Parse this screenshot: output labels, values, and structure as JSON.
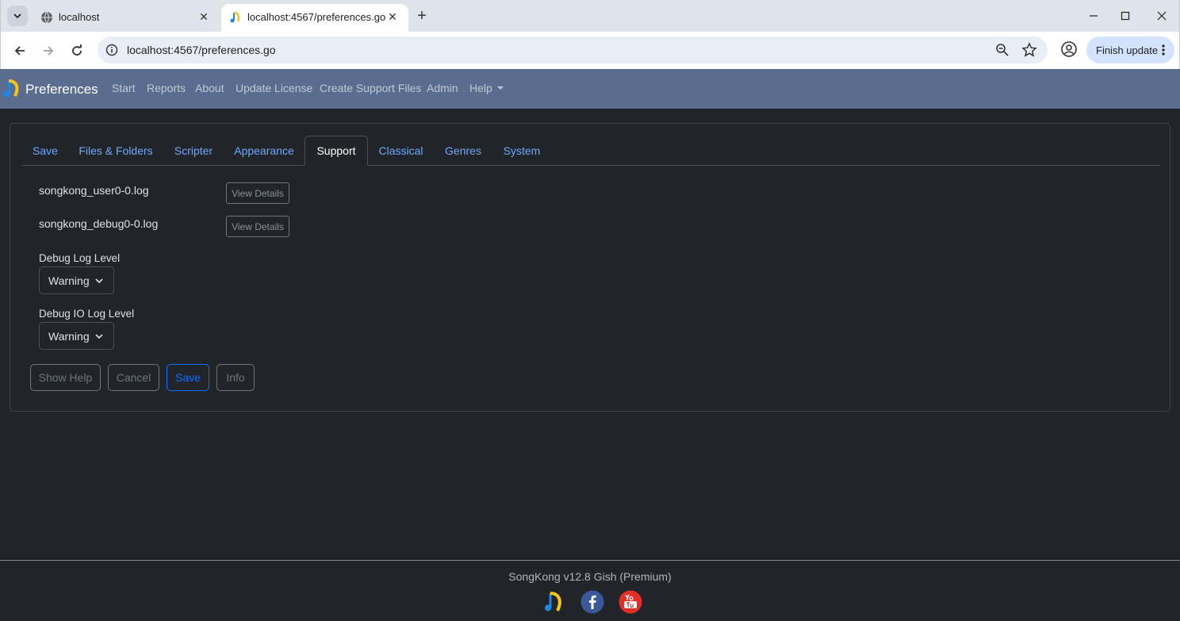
{
  "browser": {
    "tabs": [
      {
        "title": "localhost",
        "active": false
      },
      {
        "title": "localhost:4567/preferences.go",
        "active": true
      }
    ],
    "url": "localhost:4567/preferences.go",
    "finish_update_label": "Finish update"
  },
  "navbar": {
    "brand": "Preferences",
    "links": [
      "Start",
      "Reports",
      "About",
      "Update License",
      "Create Support Files",
      "Admin",
      "Help"
    ]
  },
  "pref_tabs": [
    "Save",
    "Files & Folders",
    "Scripter",
    "Appearance",
    "Support",
    "Classical",
    "Genres",
    "System"
  ],
  "active_tab": "Support",
  "support": {
    "logs": [
      {
        "name": "songkong_user0-0.log",
        "button": "View Details"
      },
      {
        "name": "songkong_debug0-0.log",
        "button": "View Details"
      }
    ],
    "debug_log_level": {
      "label": "Debug Log Level",
      "value": "Warning"
    },
    "debug_io_log_level": {
      "label": "Debug IO Log Level",
      "value": "Warning"
    }
  },
  "actions": {
    "show_help": "Show Help",
    "cancel": "Cancel",
    "save": "Save",
    "info": "Info"
  },
  "footer": {
    "version": "SongKong v12.8 Gish (Premium)"
  },
  "colors": {
    "navbar_bg": "#5a6d8e",
    "page_bg": "#212529",
    "link": "#6ea8fe",
    "primary": "#0d6efd"
  }
}
